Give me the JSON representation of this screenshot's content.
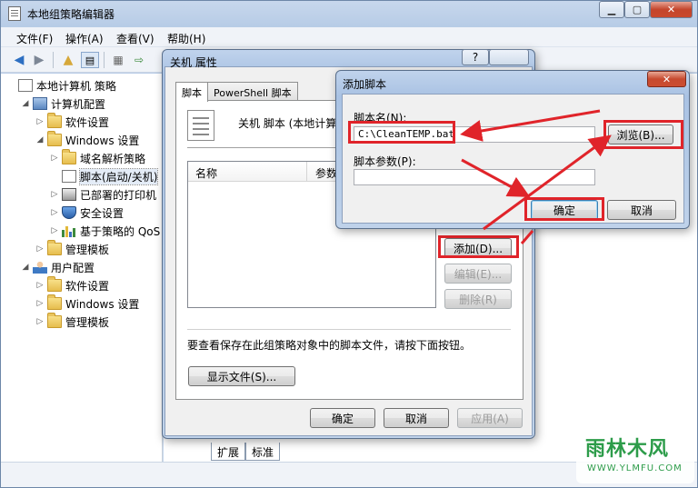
{
  "app": {
    "title": "本地组策略编辑器"
  },
  "menu": [
    "文件(F)",
    "操作(A)",
    "查看(V)",
    "帮助(H)"
  ],
  "tree": [
    {
      "label": "本地计算机 策略",
      "icon": "document-icon",
      "depth": 0,
      "expander": ""
    },
    {
      "label": "计算机配置",
      "icon": "computer-icon",
      "depth": 1,
      "expander": "expanded"
    },
    {
      "label": "软件设置",
      "icon": "folder-icon",
      "depth": 2,
      "expander": "collapsed"
    },
    {
      "label": "Windows 设置",
      "icon": "folder-icon",
      "depth": 2,
      "expander": "expanded"
    },
    {
      "label": "域名解析策略",
      "icon": "folder-icon",
      "depth": 3,
      "expander": "collapsed"
    },
    {
      "label": "脚本(启动/关机)",
      "icon": "script-icon",
      "depth": 3,
      "expander": "",
      "selected": true
    },
    {
      "label": "已部署的打印机",
      "icon": "printer-icon",
      "depth": 3,
      "expander": "collapsed"
    },
    {
      "label": "安全设置",
      "icon": "security-icon",
      "depth": 3,
      "expander": "collapsed"
    },
    {
      "label": "基于策略的 QoS",
      "icon": "bar-chart-icon",
      "depth": 3,
      "expander": "collapsed"
    },
    {
      "label": "管理模板",
      "icon": "folder-icon",
      "depth": 2,
      "expander": "collapsed"
    },
    {
      "label": "用户配置",
      "icon": "user-icon",
      "depth": 1,
      "expander": "expanded"
    },
    {
      "label": "软件设置",
      "icon": "folder-icon",
      "depth": 2,
      "expander": "collapsed"
    },
    {
      "label": "Windows 设置",
      "icon": "folder-icon",
      "depth": 2,
      "expander": "collapsed"
    },
    {
      "label": "管理模板",
      "icon": "folder-icon",
      "depth": 2,
      "expander": "collapsed"
    }
  ],
  "bottom_tabs": [
    "扩展",
    "标准"
  ],
  "props_dialog": {
    "title": "关机 属性",
    "help": "?",
    "tabs": [
      "脚本",
      "PowerShell 脚本"
    ],
    "heading": "关机 脚本 (本地计算",
    "columns": [
      "名称",
      "参数"
    ],
    "add": "添加(D)...",
    "edit": "编辑(E)...",
    "remove": "删除(R)",
    "show_desc": "要查看保存在此组策略对象中的脚本文件，请按下面按钮。",
    "show_files": "显示文件(S)...",
    "ok": "确定",
    "cancel": "取消",
    "apply": "应用(A)"
  },
  "add_dialog": {
    "title": "添加脚本",
    "name_label": "脚本名(N):",
    "name_value": "C:\\CleanTEMP.bat",
    "browse": "浏览(B)...",
    "params_label": "脚本参数(P):",
    "params_value": "",
    "ok": "确定",
    "cancel": "取消",
    "close": "✕"
  },
  "watermark": {
    "brand": "雨林木风",
    "url": "WWW.YLMFU.COM"
  },
  "colors": {
    "highlight": "#e0242a",
    "watermark": "#2d9c4a"
  }
}
